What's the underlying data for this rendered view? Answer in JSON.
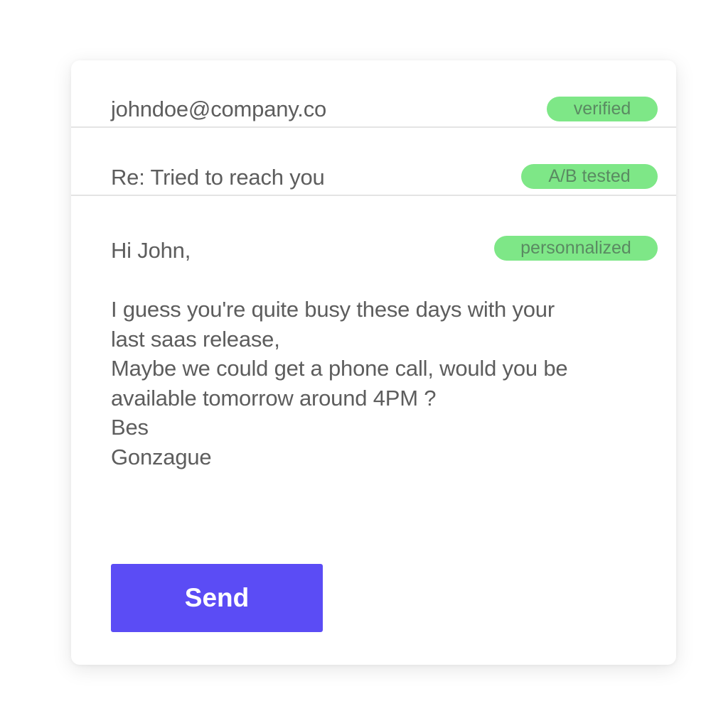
{
  "email": {
    "to": {
      "address": "johndoe@company.co",
      "badge": "verified"
    },
    "subject": {
      "text": "Re: Tried to reach you",
      "badge": "A/B tested"
    },
    "body": {
      "greeting": "Hi John,",
      "badge": "personnalized",
      "lines": [
        "I guess you're quite busy these days with your",
        "last saas release,",
        "Maybe we could get a phone call, would you be",
        "available tomorrow around 4PM ?",
        "Bes",
        "Gonzague"
      ]
    },
    "send_label": "Send"
  },
  "colors": {
    "accent": "#5b4cf5",
    "badge_bg": "#7ee787",
    "badge_text": "#5a8a62",
    "text": "#5d5d5d",
    "divider": "#e4e4e4"
  }
}
